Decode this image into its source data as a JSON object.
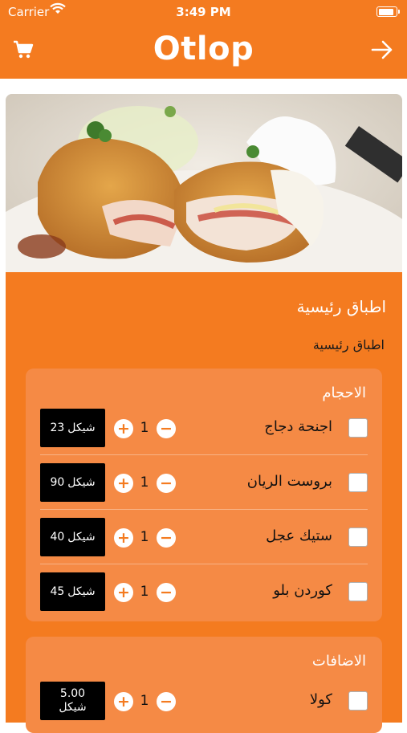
{
  "status_bar": {
    "carrier": "Carrier",
    "time": "3:49 PM"
  },
  "header": {
    "title": "Otlop",
    "cart_icon": "cart-icon",
    "forward_icon": "arrow-right-icon"
  },
  "hero": {
    "alt": "chicken cordon bleu dish"
  },
  "category": {
    "title": "اطباق رئيسية",
    "subtitle": "اطباق رئيسية"
  },
  "groups": [
    {
      "title": "الاحجام",
      "items": [
        {
          "name": "اجنحة دجاج",
          "qty": "1",
          "price": "23",
          "currency": "شيكل"
        },
        {
          "name": "بروست الريان",
          "qty": "1",
          "price": "90",
          "currency": "شيكل"
        },
        {
          "name": "ستيك عجل",
          "qty": "1",
          "price": "40",
          "currency": "شيكل"
        },
        {
          "name": "كوردن بلو",
          "qty": "1",
          "price": "45",
          "currency": "شيكل"
        }
      ]
    },
    {
      "title": "الاضافات",
      "items": [
        {
          "name": "كولا",
          "qty": "1",
          "price": "5.00",
          "currency": "شيكل"
        }
      ]
    }
  ],
  "colors": {
    "brand": "#f47b20",
    "card": "#f58a45"
  },
  "controls": {
    "plus": "+",
    "minus": "−"
  }
}
